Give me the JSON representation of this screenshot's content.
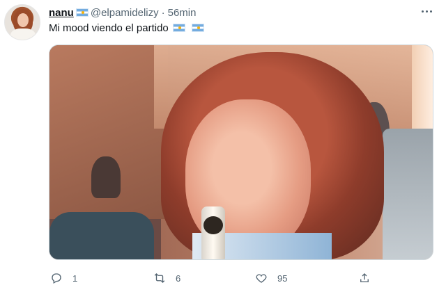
{
  "author": {
    "name": "nanu",
    "handle": "@elpamidelizy",
    "separator": "·",
    "time": "56min"
  },
  "tweet": {
    "text": "Mi mood viendo el partido"
  },
  "actions": {
    "reply_count": "1",
    "retweet_count": "6",
    "like_count": "95"
  },
  "icons": [
    "more-icon",
    "reply-icon",
    "retweet-icon",
    "like-icon",
    "share-icon",
    "argentina-flag-icon"
  ],
  "colors": {
    "text_primary": "#0f1419",
    "text_secondary": "#536471",
    "flag_blue": "#74acdf"
  }
}
